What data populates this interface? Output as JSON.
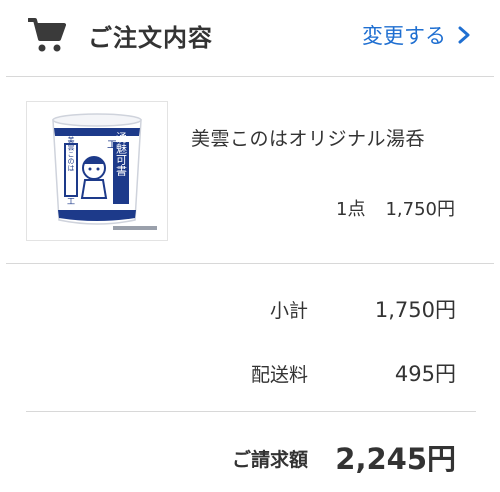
{
  "header": {
    "title": "ご注文内容",
    "change_label": "変更する",
    "cart_icon": "cart-icon",
    "chevron_icon": "chevron-right-icon"
  },
  "product": {
    "name": "美雲このはオリジナル湯呑",
    "quantity": "1点",
    "price": "1,750円",
    "cup_text_main": "美雲このは",
    "cup_text_side": "湧魅可書"
  },
  "summary": {
    "subtotal_label": "小計",
    "subtotal_value": "1,750円",
    "shipping_label": "配送料",
    "shipping_value": "495円",
    "total_label": "ご請求額",
    "total_value": "2,245円"
  },
  "colors": {
    "accent": "#1f6fd1",
    "text": "#333333",
    "divider": "#d8d8d8",
    "cup_blue": "#1d3a8a"
  }
}
